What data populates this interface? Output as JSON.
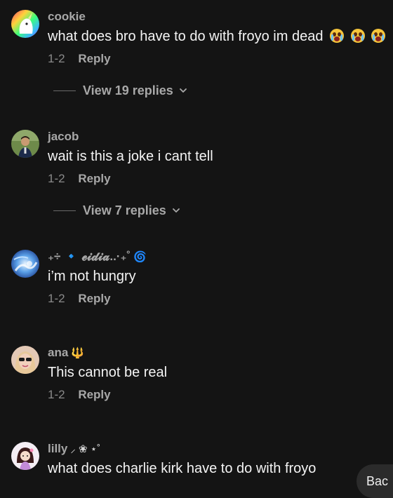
{
  "comments": [
    {
      "username": "cookie",
      "text": "what does bro have to do with froyo im dead",
      "emojis": [
        "loudly-crying-face-emoji",
        "loudly-crying-face-emoji",
        "loudly-crying-face-emoji"
      ],
      "date": "1-2",
      "reply_label": "Reply",
      "view_replies": "View 19 replies"
    },
    {
      "username": "jacob",
      "text": "wait is this a joke i cant tell",
      "date": "1-2",
      "reply_label": "Reply",
      "view_replies": "View 7 replies"
    },
    {
      "username": "₊÷ 🔹 𝓮𝓲𝓭𝓲𝓪..·₊˚",
      "username_extra": "🌀",
      "text": "i’m not hungry",
      "date": "1-2",
      "reply_label": "Reply"
    },
    {
      "username": "ana",
      "username_extra": "🔱",
      "text": "This cannot be real",
      "date": "1-2",
      "reply_label": "Reply"
    },
    {
      "username": "lilly",
      "username_extra": "⸝ ❀ ⋆˚",
      "text": "what does charlie kirk have to do with froyo"
    }
  ],
  "back_button_label": "Bac",
  "icons": {
    "chevron": "chevron-down-icon",
    "emoji": "loudly-crying-face-emoji"
  },
  "colors": {
    "background": "#141414",
    "username": "#a8a8a8",
    "text": "#f4f4f4",
    "meta": "#8a8a8a"
  }
}
